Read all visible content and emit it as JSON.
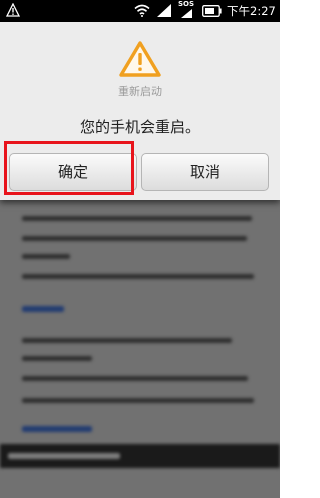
{
  "status_bar": {
    "time": "下午2:27",
    "sos_label": "SOS",
    "warning_icon": "warning-icon",
    "wifi_icon": "wifi-icon",
    "signal_icon": "signal-icon",
    "battery_icon": "battery-icon"
  },
  "dialog": {
    "icon": "warning-icon",
    "title": "重新启动",
    "message": "您的手机会重启。",
    "confirm_label": "确定",
    "cancel_label": "取消",
    "highlight_color": "#e8141c",
    "accent_color": "#f0a020"
  }
}
